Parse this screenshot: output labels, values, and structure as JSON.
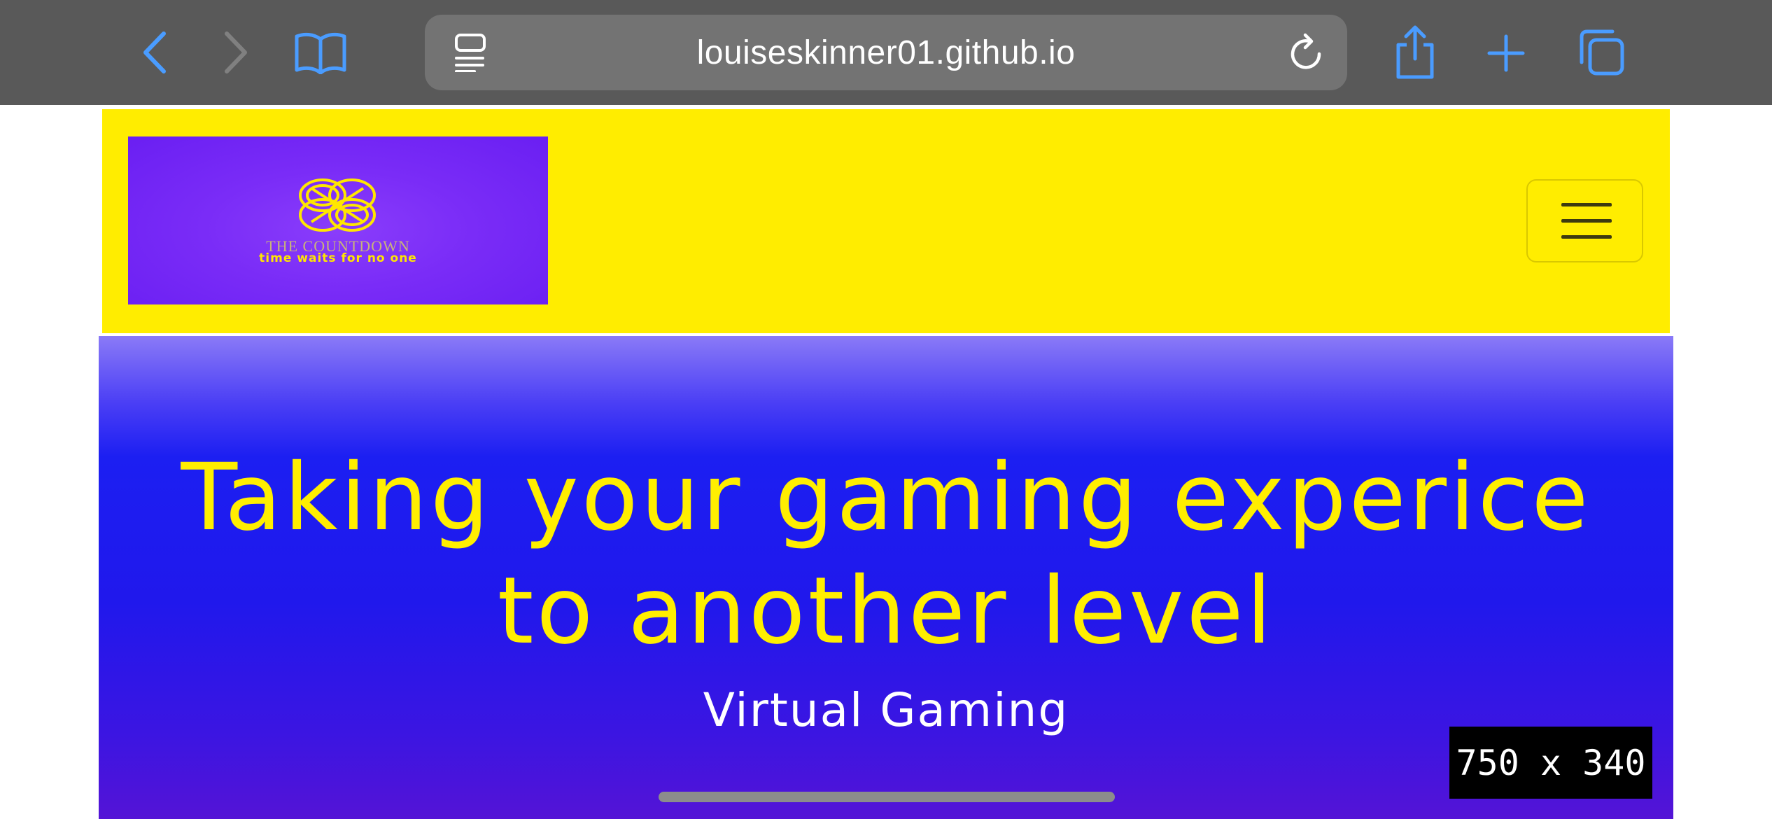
{
  "browser": {
    "url": "louiseskinner01.github.io",
    "icons": {
      "back": "chevron-left-icon",
      "forward": "chevron-right-icon",
      "bookmarks": "book-icon",
      "reader": "reader-mode-icon",
      "reload": "reload-icon",
      "share": "share-icon",
      "new_tab": "plus-icon",
      "tabs": "tabs-icon"
    },
    "colors": {
      "toolbar_bg": "#595959",
      "icon_blue": "#4a9cff"
    }
  },
  "navbar": {
    "logo": {
      "title": "THE COUNTDOWN",
      "tagline": "time waits for no one"
    },
    "menu_icon": "hamburger-menu-icon",
    "colors": {
      "background": "#ffed00",
      "logo_bg": "#7a2cf7"
    }
  },
  "hero": {
    "title_line1": "Taking your gaming experice",
    "title_line2": "to another level",
    "subtitle": "Virtual Gaming",
    "colors": {
      "title": "#ffee00",
      "subtitle": "#ffffff"
    }
  },
  "overlay": {
    "viewport_size": "750 x 340"
  }
}
